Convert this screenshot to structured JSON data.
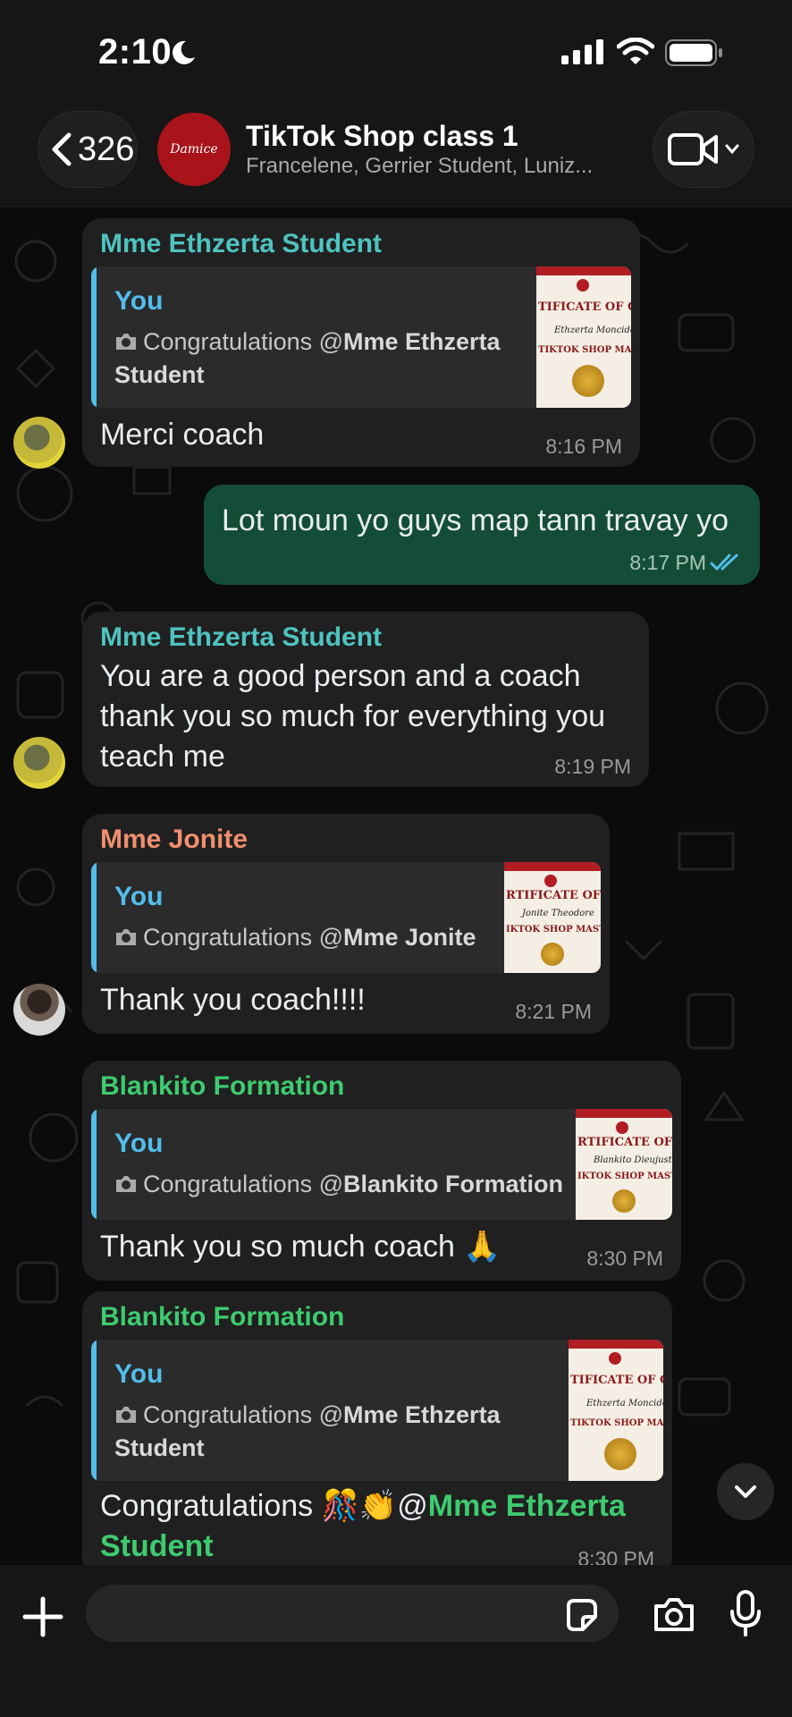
{
  "status_bar": {
    "time": "2:10"
  },
  "header": {
    "back_count": "326",
    "title": "TikTok Shop class 1",
    "subtitle": "Francelene, Gerrier Student, Luniz...",
    "avatar_text": "Damice"
  },
  "messages": [
    {
      "sender": "Mme Ethzerta Student",
      "sender_color": "#4fc3c0",
      "quote_author": "You",
      "quote_prefix": "Congratulations @",
      "quote_mention_line1": "Mme Ethzerta",
      "quote_mention_line2": "Student",
      "text": "Merci coach",
      "time": "8:16 PM"
    },
    {
      "outgoing": true,
      "text": "Lot moun yo guys map tann travay yo",
      "time": "8:17 PM",
      "read_receipt": "double-check-icon"
    },
    {
      "sender": "Mme Ethzerta Student",
      "sender_color": "#4fc3c0",
      "text_lines": [
        "You are a good person and a coach",
        "thank you so much for everything you",
        "teach me"
      ],
      "time": "8:19 PM"
    },
    {
      "sender": "Mme Jonite",
      "sender_color": "#f08f6e",
      "quote_author": "You",
      "quote_prefix": "Congratulations @",
      "quote_mention_line1": "Mme Jonite",
      "text": "Thank you coach!!!!",
      "time": "8:21 PM"
    },
    {
      "sender": "Blankito Formation",
      "sender_color": "#3ecb6f",
      "quote_author": "You",
      "quote_prefix": "Congratulations @",
      "quote_mention_line1": "Blankito Formation",
      "text": "Thank you so much coach 🙏",
      "time": "8:30 PM"
    },
    {
      "sender": "Blankito Formation",
      "sender_color": "#3ecb6f",
      "quote_author": "You",
      "quote_prefix": "Congratulations @",
      "quote_mention_line1": "Mme Ethzerta",
      "quote_mention_line2": "Student",
      "text_prefix": "Congratulations 🎊👏@",
      "text_mention_line1": "Mme Ethzerta",
      "text_mention_line2": "Student",
      "mention_color": "#3ecb6f",
      "time": "8:30 PM"
    }
  ],
  "certificate_thumbs": [
    {
      "title": "TIFICATE OF COMPLE",
      "name": "Ethzerta Moncide Augustin",
      "program": "TIKTOK SHOP MASTERY PROG"
    },
    {
      "title": "RTIFICATE OF COMPLET",
      "name": "Jonite Theodore",
      "program": "IKTOK SHOP MASTERY PROGRA"
    },
    {
      "title": "RTIFICATE OF COMPLET",
      "name": "Blankito Dieujuste",
      "program": "IKTOK SHOP MASTERY PROGRA"
    }
  ],
  "composer": {
    "placeholder": ""
  },
  "colors": {
    "accent_blue": "#53bdeb",
    "outgoing_bubble": "#144d37",
    "incoming_bubble": "#202020"
  }
}
